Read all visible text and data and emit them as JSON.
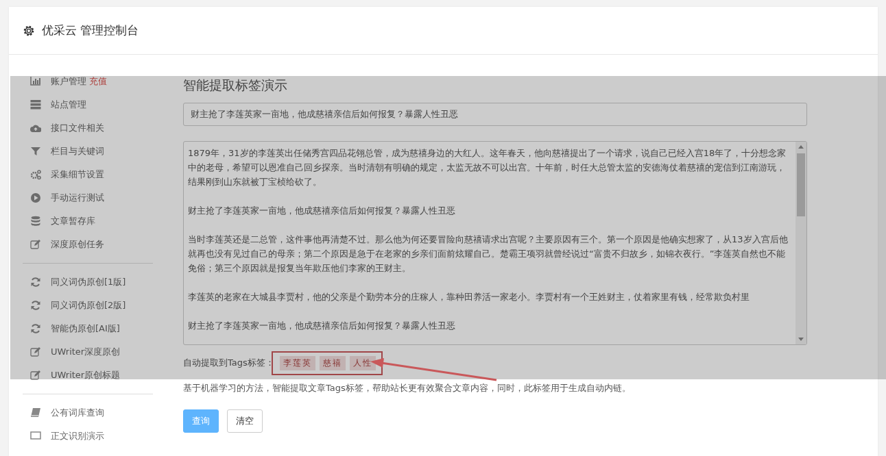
{
  "header": {
    "title": "优采云 管理控制台"
  },
  "sidebar": {
    "groups": [
      {
        "items": [
          {
            "label": "账户管理",
            "link": "充值"
          },
          {
            "label": "站点管理"
          },
          {
            "label": "接口文件相关"
          },
          {
            "label": "栏目与关键词"
          },
          {
            "label": "采集细节设置"
          },
          {
            "label": "手动运行测试"
          },
          {
            "label": "文章暂存库"
          },
          {
            "label": "深度原创任务"
          }
        ]
      },
      {
        "items": [
          {
            "label": "同义词伪原创[1版]"
          },
          {
            "label": "同义词伪原创[2版]"
          },
          {
            "label": "智能伪原创[AI版]"
          },
          {
            "label": "UWriter深度原创"
          },
          {
            "label": "UWriter原创标题"
          }
        ]
      },
      {
        "items": [
          {
            "label": "公有词库查询"
          },
          {
            "label": "正文识别演示"
          }
        ]
      }
    ]
  },
  "main": {
    "title": "智能提取标签演示",
    "title_field": {
      "value": "财主抢了李莲英家一亩地，他成慈禧亲信后如何报复？暴露人性丑恶"
    },
    "content_field": {
      "paragraphs": [
        "1879年，31岁的李莲英出任储秀宫四品花翎总管，成为慈禧身边的大红人。这年春天，他向慈禧提出了一个请求，说自己已经入宫18年了，十分想念家中的老母，希望可以恩准自己回乡探亲。当时清朝有明确的规定，太监无故不可以出宫。十年前，时任大总管太监的安德海仗着慈禧的宠信到江南游玩，结果刚到山东就被丁宝桢给砍了。",
        "财主抢了李莲英家一亩地，他成慈禧亲信后如何报复？暴露人性丑恶",
        "当时李莲英还是二总管，这件事他再清楚不过。那么他为何还要冒险向慈禧请求出宫呢？主要原因有三个。第一个原因是他确实想家了，从13岁入宫后他就再也没有见过自己的母亲；第二个原因是急于在老家的乡亲们面前炫耀自己。楚霸王项羽就曾经说过“富贵不归故乡，如锦衣夜行。”李莲英自然也不能免俗；第三个原因就是报复当年欺压他们李家的王财主。",
        "李莲英的老家在大城县李贾村，他的父亲是个勤劳本分的庄稼人，靠种田养活一家老小。李贾村有一个王姓财主，仗着家里有钱，经常欺负村里",
        "财主抢了李莲英家一亩地，他成慈禧亲信后如何报复？暴露人性丑恶"
      ]
    },
    "tags_label": "自动提取到Tags标签：",
    "tags": [
      "李莲英",
      "慈禧",
      "人性"
    ],
    "description": "基于机器学习的方法，智能提取文章Tags标签，帮助站长更有效聚合文章内容，同时，此标签用于生成自动内链。",
    "buttons": [
      {
        "label": "查询",
        "kind": "primary"
      },
      {
        "label": "清空",
        "kind": "default"
      }
    ]
  }
}
